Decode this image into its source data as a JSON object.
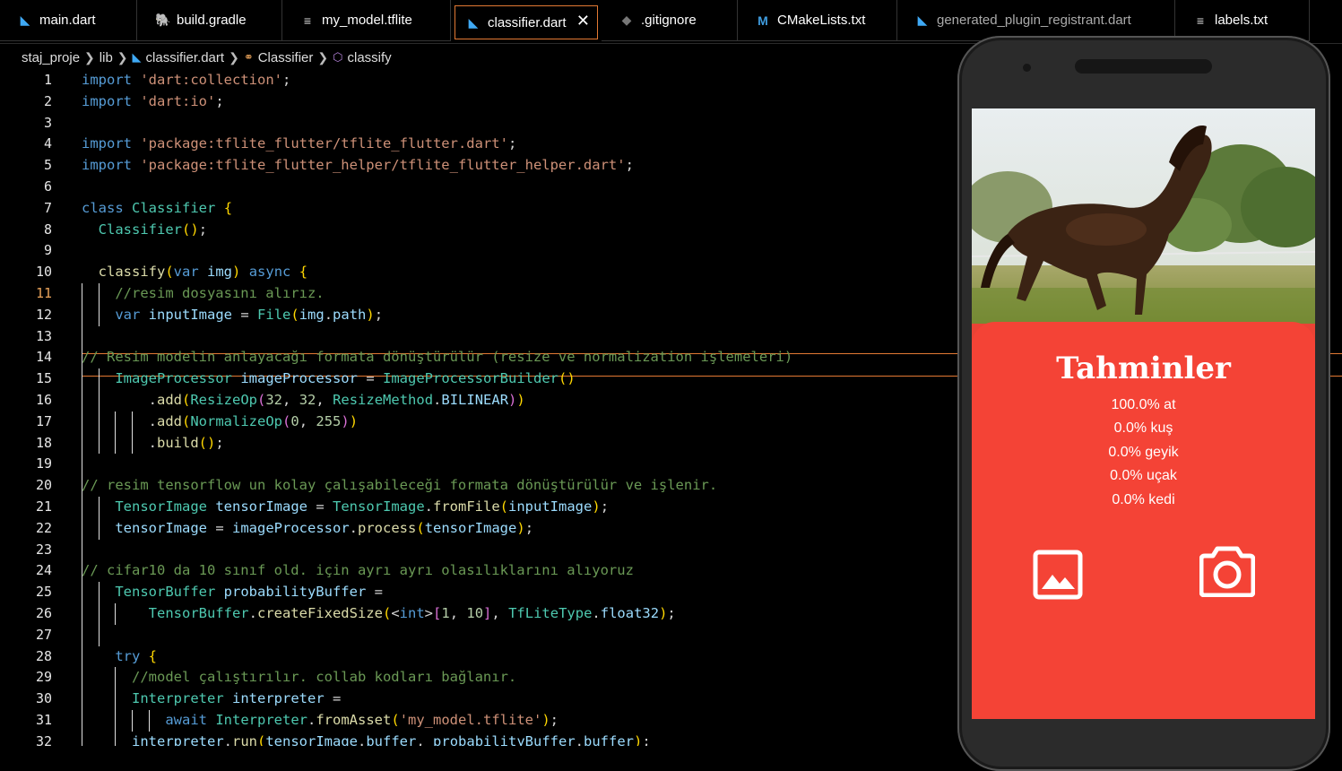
{
  "tabs": [
    {
      "label": "main.dart",
      "icon": "dart-icon"
    },
    {
      "label": "build.gradle",
      "icon": "gradle-icon"
    },
    {
      "label": "my_model.tflite",
      "icon": "list-icon"
    },
    {
      "label": "classifier.dart",
      "icon": "dart-icon",
      "active": true
    },
    {
      "label": ".gitignore",
      "icon": "diamond-icon"
    },
    {
      "label": "CMakeLists.txt",
      "icon": "cmake-icon"
    },
    {
      "label": "generated_plugin_registrant.dart",
      "icon": "dart-icon"
    },
    {
      "label": "labels.txt",
      "icon": "list-icon"
    }
  ],
  "tab_close_glyph": "✕",
  "breadcrumb": {
    "items": [
      "staj_proje",
      "lib",
      "classifier.dart",
      "Classifier",
      "classify"
    ]
  },
  "editor": {
    "current_line": 11,
    "lines": [
      {
        "n": "1",
        "text": "import 'dart:collection';"
      },
      {
        "n": "2",
        "text": "import 'dart:io';"
      },
      {
        "n": "3",
        "text": ""
      },
      {
        "n": "4",
        "text": "import 'package:tflite_flutter/tflite_flutter.dart';"
      },
      {
        "n": "5",
        "text": "import 'package:tflite_flutter_helper/tflite_flutter_helper.dart';"
      },
      {
        "n": "6",
        "text": ""
      },
      {
        "n": "7",
        "text": "class Classifier {"
      },
      {
        "n": "8",
        "text": "  Classifier();"
      },
      {
        "n": "9",
        "text": ""
      },
      {
        "n": "10",
        "text": "  classify(var img) async {"
      },
      {
        "n": "11",
        "text": "    //resim dosyasını alırız."
      },
      {
        "n": "12",
        "text": "    var inputImage = File(img.path);"
      },
      {
        "n": "13",
        "text": ""
      },
      {
        "n": "14",
        "text": "// Resim modelin anlayacağı formata dönüştürülür (resize ve normalization işlemeleri)"
      },
      {
        "n": "15",
        "text": "    ImageProcessor imageProcessor = ImageProcessorBuilder()"
      },
      {
        "n": "16",
        "text": "        .add(ResizeOp(32, 32, ResizeMethod.BILINEAR))"
      },
      {
        "n": "17",
        "text": "        .add(NormalizeOp(0, 255))"
      },
      {
        "n": "18",
        "text": "        .build();"
      },
      {
        "n": "19",
        "text": ""
      },
      {
        "n": "20",
        "text": "// resim tensorflow un kolay çalışabileceği formata dönüştürülür ve işlenir."
      },
      {
        "n": "21",
        "text": "    TensorImage tensorImage = TensorImage.fromFile(inputImage);"
      },
      {
        "n": "22",
        "text": "    tensorImage = imageProcessor.process(tensorImage);"
      },
      {
        "n": "23",
        "text": ""
      },
      {
        "n": "24",
        "text": "// cifar10 da 10 sınıf old. için ayrı ayrı olasılıklarını alıyoruz"
      },
      {
        "n": "25",
        "text": "    TensorBuffer probabilityBuffer ="
      },
      {
        "n": "26",
        "text": "        TensorBuffer.createFixedSize(<int>[1, 10], TfLiteType.float32);"
      },
      {
        "n": "27",
        "text": ""
      },
      {
        "n": "28",
        "text": "    try {"
      },
      {
        "n": "29",
        "text": "      //model çalıştırılır. collab kodları bağlanır."
      },
      {
        "n": "30",
        "text": "      Interpreter interpreter ="
      },
      {
        "n": "31",
        "text": "          await Interpreter.fromAsset('my_model.tflite');"
      },
      {
        "n": "32",
        "text": "      interpreter.run(tensorImage.buffer, probabilityBuffer.buffer);"
      }
    ]
  },
  "phone": {
    "title": "Tahminler",
    "predictions": [
      "100.0% at",
      "0.0% kuş",
      "0.0% geyik",
      "0.0% uçak",
      "0.0% kedi"
    ],
    "gallery_icon": "image-icon",
    "camera_icon": "camera-icon"
  },
  "colors": {
    "accent_orange": "#e37933",
    "panel_red": "#f44336",
    "dart_blue": "#3fa9f5"
  }
}
